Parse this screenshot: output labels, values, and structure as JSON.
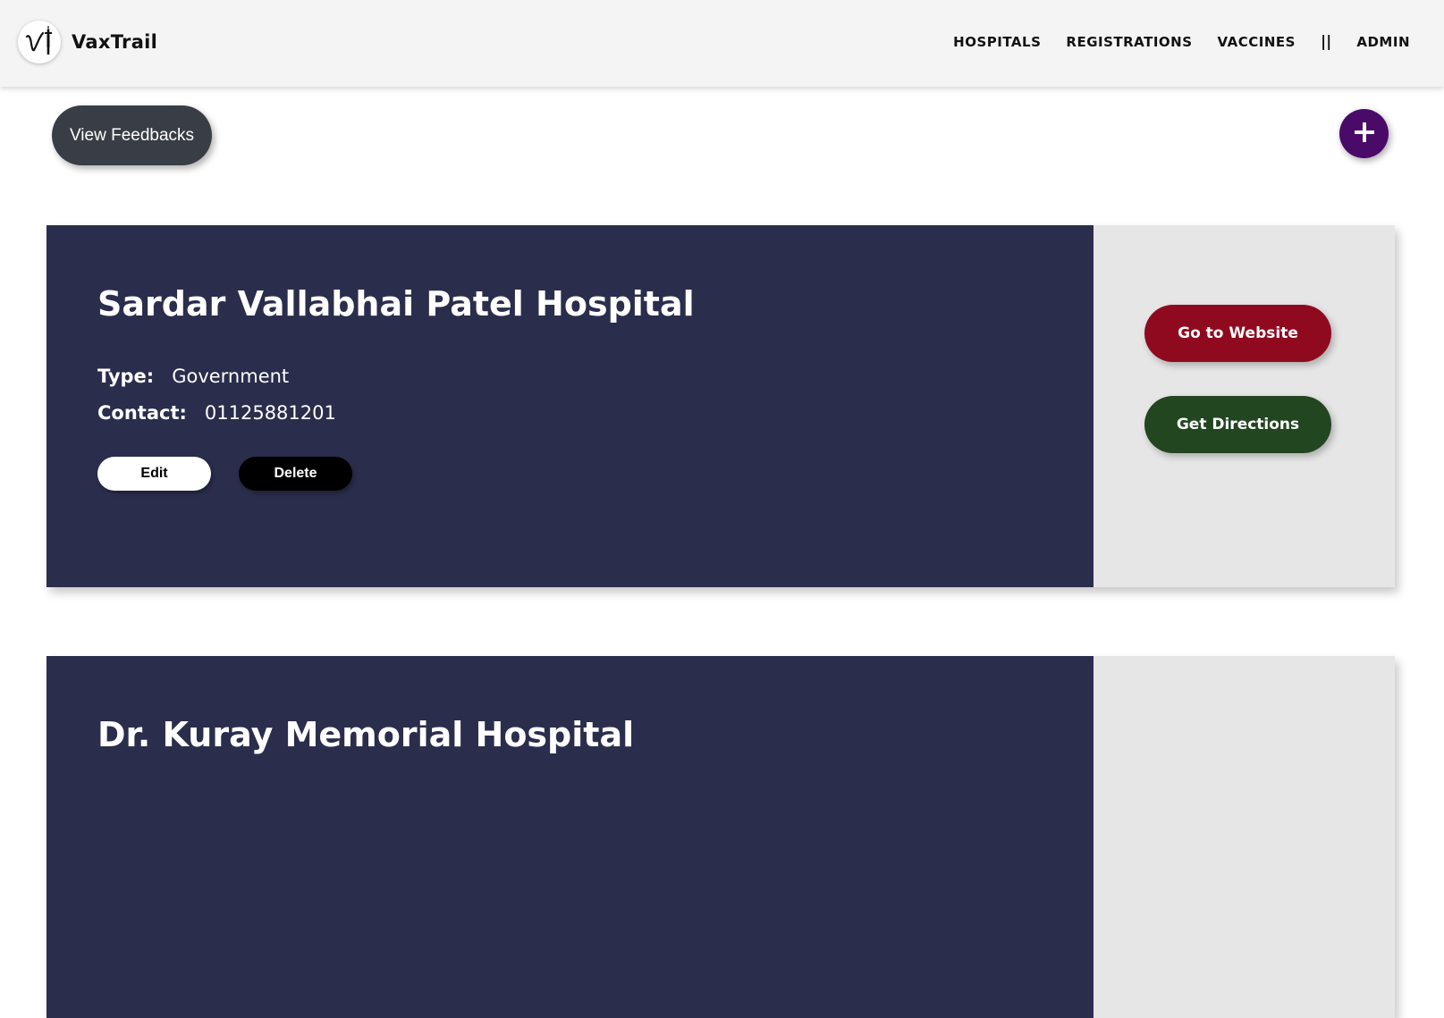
{
  "brand": {
    "name": "VaxTrail",
    "logo_icon": "syringe-vt-logo-icon"
  },
  "nav": {
    "items": [
      {
        "label": "HOSPITALS"
      },
      {
        "label": "REGISTRATIONS"
      },
      {
        "label": "VACCINES"
      }
    ],
    "separator": "||",
    "admin_label": "ADMIN"
  },
  "actions": {
    "view_feedbacks_label": "View Feedbacks",
    "add_icon": "plus-icon"
  },
  "hospitals": [
    {
      "name": "Sardar Vallabhai Patel Hospital",
      "type_label": "Type:",
      "type_value": "Government",
      "contact_label": "Contact:",
      "contact_value": "01125881201",
      "edit_label": "Edit",
      "delete_label": "Delete",
      "website_label": "Go to Website",
      "directions_label": "Get Directions"
    },
    {
      "name": "Dr. Kuray Memorial Hospital"
    }
  ],
  "colors": {
    "navbar_bg": "#f4f4f4",
    "card_bg": "#2b2d4c",
    "card_side_bg": "#e6e6e6",
    "feedback_btn": "#393d45",
    "add_btn": "#4a0a68",
    "website_btn": "#8f0a1f",
    "directions_btn": "#224620"
  }
}
